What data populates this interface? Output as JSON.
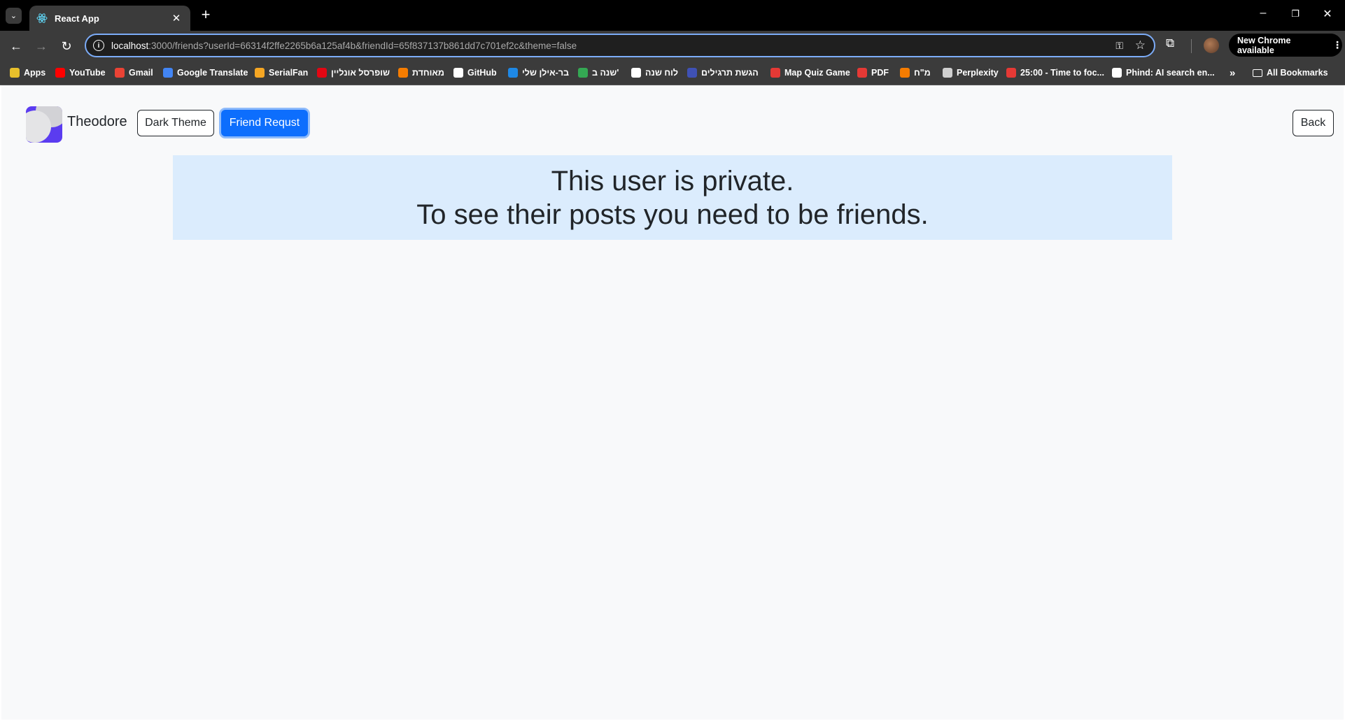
{
  "browser": {
    "tab_title": "React App",
    "url_host": "localhost",
    "url_path": ":3000/friends?userId=66314f2ffe2265b6a125af4b&friendId=65f837137b861dd7c701ef2c&theme=false",
    "new_chrome_label": "New Chrome available",
    "bookmarks": [
      {
        "label": "Apps",
        "icon": "apps-grid-icon",
        "color": "#e8c02b"
      },
      {
        "label": "YouTube",
        "icon": "youtube-icon",
        "color": "#ff0000"
      },
      {
        "label": "Gmail",
        "icon": "gmail-icon",
        "color": "#ea4335"
      },
      {
        "label": "Google Translate",
        "icon": "translate-icon",
        "color": "#4285f4"
      },
      {
        "label": "SerialFan",
        "icon": "serialfan-icon",
        "color": "#f5a623"
      },
      {
        "label": "שופרסל אונליין",
        "icon": "shufersal-icon",
        "color": "#e30613"
      },
      {
        "label": "מאוחדת",
        "icon": "meuhedet-icon",
        "color": "#f57c00"
      },
      {
        "label": "GitHub",
        "icon": "github-icon",
        "color": "#ffffff"
      },
      {
        "label": "בר-אילן שלי",
        "icon": "biu-icon",
        "color": "#1e88e5"
      },
      {
        "label": "שנה ב'",
        "icon": "drive-icon",
        "color": "#34a853"
      },
      {
        "label": "לוח שנה",
        "icon": "calendar-icon",
        "color": "#ffffff"
      },
      {
        "label": "הגשת תרגילים",
        "icon": "upload-icon",
        "color": "#3f51b5"
      },
      {
        "label": "Map Quiz Game",
        "icon": "map-pin-icon",
        "color": "#e53935"
      },
      {
        "label": "PDF",
        "icon": "pdf-heart-icon",
        "color": "#e53935"
      },
      {
        "label": "מ\"ח",
        "icon": "mh-icon",
        "color": "#f57c00"
      },
      {
        "label": "Perplexity",
        "icon": "perplexity-icon",
        "color": "#cfcfcf"
      },
      {
        "label": "25:00 - Time to foc...",
        "icon": "pomodoro-icon",
        "color": "#e53935"
      },
      {
        "label": "Phind: AI search en...",
        "icon": "phind-icon",
        "color": "#ffffff"
      }
    ],
    "all_bookmarks_label": "All Bookmarks"
  },
  "header": {
    "username": "Theodore",
    "dark_theme_label": "Dark Theme",
    "friend_request_label": "Friend Requst",
    "back_label": "Back"
  },
  "alert": {
    "line1": "This user is private.",
    "line2": "To see their posts you need to be friends."
  },
  "colors": {
    "primary": "#0d6efd",
    "alert_bg": "#dbecfd",
    "page_bg": "#f8f9fa"
  }
}
